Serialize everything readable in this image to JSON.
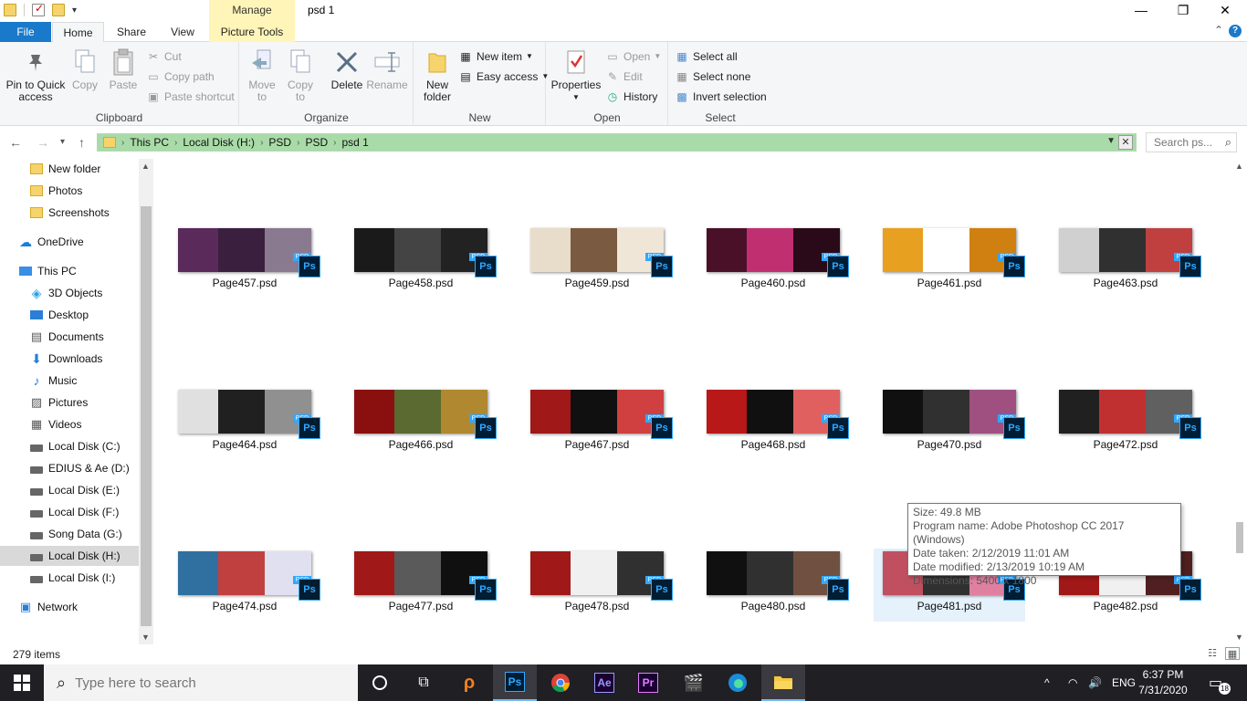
{
  "titlebar": {
    "manage_tab": "Manage",
    "window_title": "psd 1",
    "minimize": "—",
    "maximize": "❐",
    "close": "✕"
  },
  "ribbon_tabs": {
    "file": "File",
    "home": "Home",
    "share": "Share",
    "view": "View",
    "picture_tools": "Picture Tools"
  },
  "ribbon": {
    "clipboard": {
      "label": "Clipboard",
      "pin_to_quick_access": "Pin to Quick access",
      "copy": "Copy",
      "paste": "Paste",
      "cut": "Cut",
      "copy_path": "Copy path",
      "paste_shortcut": "Paste shortcut"
    },
    "organize": {
      "label": "Organize",
      "move_to": "Move to",
      "copy_to": "Copy to",
      "delete": "Delete",
      "rename": "Rename"
    },
    "new": {
      "label": "New",
      "new_folder": "New folder",
      "new_item": "New item",
      "easy_access": "Easy access"
    },
    "open": {
      "label": "Open",
      "properties": "Properties",
      "open": "Open",
      "edit": "Edit",
      "history": "History"
    },
    "select": {
      "label": "Select",
      "select_all": "Select all",
      "select_none": "Select none",
      "invert_selection": "Invert selection"
    }
  },
  "address": {
    "crumbs": [
      "This PC",
      "Local Disk (H:)",
      "PSD",
      "PSD",
      "psd 1"
    ],
    "search_placeholder": "Search ps..."
  },
  "nav_pane": {
    "items": [
      {
        "label": "New folder",
        "icon": "folder-icon"
      },
      {
        "label": "Photos",
        "icon": "folder-icon"
      },
      {
        "label": "Screenshots",
        "icon": "folder-icon"
      },
      {
        "label": "OneDrive",
        "icon": "onedrive-icon"
      },
      {
        "label": "This PC",
        "icon": "this-pc-icon"
      },
      {
        "label": "3D Objects",
        "icon": "3d-objects-icon"
      },
      {
        "label": "Desktop",
        "icon": "desktop-icon"
      },
      {
        "label": "Documents",
        "icon": "documents-icon"
      },
      {
        "label": "Downloads",
        "icon": "downloads-icon"
      },
      {
        "label": "Music",
        "icon": "music-icon"
      },
      {
        "label": "Pictures",
        "icon": "pictures-icon"
      },
      {
        "label": "Videos",
        "icon": "videos-icon"
      },
      {
        "label": "Local Disk (C:)",
        "icon": "drive-icon"
      },
      {
        "label": "EDIUS & Ae (D:)",
        "icon": "drive-icon"
      },
      {
        "label": "Local Disk (E:)",
        "icon": "drive-icon"
      },
      {
        "label": "Local Disk (F:)",
        "icon": "drive-icon"
      },
      {
        "label": "Song Data (G:)",
        "icon": "drive-icon"
      },
      {
        "label": "Local Disk (H:)",
        "icon": "drive-icon",
        "selected": true
      },
      {
        "label": "Local Disk (I:)",
        "icon": "drive-icon"
      },
      {
        "label": "Network",
        "icon": "network-icon"
      }
    ]
  },
  "files": [
    {
      "name": "Page457.psd",
      "colors": [
        "#5a2a5a",
        "#3b1f3f",
        "#8a7a90"
      ]
    },
    {
      "name": "Page458.psd",
      "colors": [
        "#1a1a1a",
        "#444444",
        "#222222"
      ]
    },
    {
      "name": "Page459.psd",
      "colors": [
        "#e8dccb",
        "#7a5a40",
        "#f0e6d8"
      ]
    },
    {
      "name": "Page460.psd",
      "colors": [
        "#4a1028",
        "#c03070",
        "#2a0a18"
      ]
    },
    {
      "name": "Page461.psd",
      "colors": [
        "#e8a020",
        "#ffffff",
        "#d08010"
      ]
    },
    {
      "name": "Page463.psd",
      "colors": [
        "#d0d0d0",
        "#303030",
        "#c04040"
      ]
    },
    {
      "name": "Page464.psd",
      "colors": [
        "#e0e0e0",
        "#202020",
        "#909090"
      ]
    },
    {
      "name": "Page466.psd",
      "colors": [
        "#8a1010",
        "#5a6a30",
        "#b08830"
      ]
    },
    {
      "name": "Page467.psd",
      "colors": [
        "#a01818",
        "#101010",
        "#d04040"
      ]
    },
    {
      "name": "Page468.psd",
      "colors": [
        "#b81818",
        "#101010",
        "#e06060"
      ]
    },
    {
      "name": "Page470.psd",
      "colors": [
        "#101010",
        "#303030",
        "#a05080"
      ]
    },
    {
      "name": "Page472.psd",
      "colors": [
        "#202020",
        "#c03030",
        "#606060"
      ]
    },
    {
      "name": "Page474.psd",
      "colors": [
        "#3070a0",
        "#c04040",
        "#e0e0f0"
      ]
    },
    {
      "name": "Page477.psd",
      "colors": [
        "#a01818",
        "#5a5a5a",
        "#101010"
      ]
    },
    {
      "name": "Page478.psd",
      "colors": [
        "#a01818",
        "#f0f0f0",
        "#303030"
      ]
    },
    {
      "name": "Page480.psd",
      "colors": [
        "#101010",
        "#303030",
        "#705040"
      ]
    },
    {
      "name": "Page481.psd",
      "colors": [
        "#c05060",
        "#303030",
        "#e080a0"
      ],
      "hover": true
    },
    {
      "name": "Page482.psd",
      "colors": [
        "#a01818",
        "#f0f0f0",
        "#502020"
      ]
    }
  ],
  "tooltip": {
    "size": "Size: 49.8 MB",
    "program": "Program name: Adobe Photoshop CC 2017 (Windows)",
    "date_taken": "Date taken: 2/12/2019 11:01 AM",
    "date_modified": "Date modified: 2/13/2019 10:19 AM",
    "dimensions": "Dimensions: 5400 x 1800"
  },
  "status": {
    "item_count": "279 items"
  },
  "taskbar": {
    "search_placeholder": "Type here to search",
    "language": "ENG",
    "time": "6:37 PM",
    "date": "7/31/2020",
    "notification_count": "18",
    "apps": [
      {
        "name": "cortana-icon"
      },
      {
        "name": "task-view-icon"
      },
      {
        "name": "search-app-icon"
      },
      {
        "name": "photoshop-icon",
        "label": "Ps"
      },
      {
        "name": "chrome-icon"
      },
      {
        "name": "after-effects-icon",
        "label": "Ae"
      },
      {
        "name": "premiere-icon",
        "label": "Pr"
      },
      {
        "name": "clapper-icon"
      },
      {
        "name": "edge-icon"
      },
      {
        "name": "file-explorer-icon"
      }
    ]
  },
  "psd_badge": "Ps",
  "psd_tag": "PSD"
}
